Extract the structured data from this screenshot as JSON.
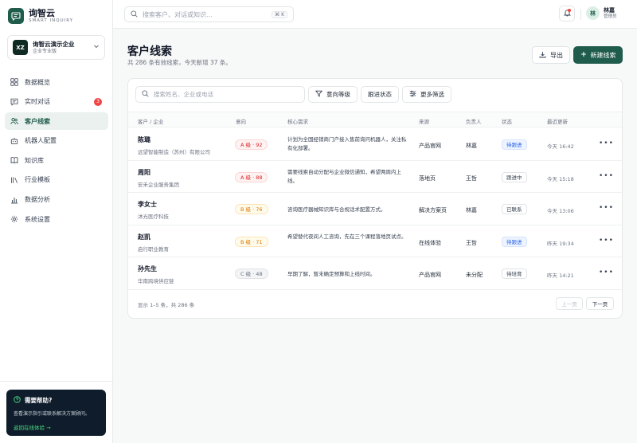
{
  "brand": {
    "name": "询智云",
    "tagline": "SMART INQUIRY"
  },
  "org": {
    "avatar": "XZ",
    "name": "询智云演示企业",
    "plan": "企业专业版"
  },
  "nav": [
    {
      "label": "数据概览",
      "icon": "grid-icon"
    },
    {
      "label": "实时对话",
      "icon": "chat-icon",
      "badge": "3"
    },
    {
      "label": "客户线索",
      "icon": "users-icon",
      "active": true
    },
    {
      "label": "机器人配置",
      "icon": "robot-icon"
    },
    {
      "label": "知识库",
      "icon": "book-icon"
    },
    {
      "label": "行业模板",
      "icon": "library-icon"
    },
    {
      "label": "数据分析",
      "icon": "bar-chart-icon"
    },
    {
      "label": "系统设置",
      "icon": "gear-icon"
    }
  ],
  "help": {
    "title": "需要帮助?",
    "desc": "查看演示指引或联系解决方案顾问。",
    "link": "返回在线体验 →"
  },
  "topbar": {
    "search_placeholder": "搜索客户、对话或知识...",
    "shortcut": "⌘ K",
    "user": {
      "avatar": "林",
      "name": "林嘉",
      "role": "管理员"
    }
  },
  "page": {
    "title": "客户线索",
    "subtitle": "共 286 条有效线索，今天新增 37 条。",
    "export_label": "导出",
    "new_label": "新建线索"
  },
  "filters": {
    "search_placeholder": "搜索姓名、企业或电话",
    "intent_label": "意向等级",
    "follow_label": "跟进状态",
    "more_label": "更多筛选"
  },
  "table": {
    "columns": [
      "客户 / 企业",
      "意向",
      "核心需求",
      "来源",
      "负责人",
      "状态",
      "最近更新"
    ],
    "rows": [
      {
        "name": "陈璐",
        "company": "远望智能制造（苏州）有限公司",
        "grade": "A 级 · 92",
        "level": "a",
        "need": "计划为全国经销商门户接入售前询问机器人，关注私有化部署。",
        "source": "产品官网",
        "owner": "林嘉",
        "status": "待跟进",
        "status_style": "blue",
        "updated": "今天 16:42"
      },
      {
        "name": "周阳",
        "company": "安禾企业服务集团",
        "grade": "A 级 · 88",
        "level": "a",
        "need": "需要线索自动分配与企业微信通知，希望两周内上线。",
        "source": "落地页",
        "owner": "王哲",
        "status": "跟进中",
        "status_style": "plain",
        "updated": "今天 15:18"
      },
      {
        "name": "李女士",
        "company": "沐光医疗科技",
        "grade": "B 级 · 76",
        "level": "b",
        "need": "咨询医疗器械知识库与合规话术配置方式。",
        "source": "解决方案页",
        "owner": "林嘉",
        "status": "已联系",
        "status_style": "plain",
        "updated": "今天 13:06"
      },
      {
        "name": "赵凯",
        "company": "启行职业教育",
        "grade": "B 级 · 71",
        "level": "b",
        "need": "希望替代夜间人工咨询，先在三个课程落地页试点。",
        "source": "在线体验",
        "owner": "王哲",
        "status": "待跟进",
        "status_style": "blue",
        "updated": "昨天 19:34"
      },
      {
        "name": "孙先生",
        "company": "华南跨境供应链",
        "grade": "C 级 · 48",
        "level": "c",
        "need": "早期了解，暂未确定预算和上线时间。",
        "source": "产品官网",
        "owner": "未分配",
        "status": "待培育",
        "status_style": "plain",
        "updated": "昨天 14:21"
      }
    ],
    "more_glyph": "•••"
  },
  "pagination": {
    "summary": "显示 1–5 条，共 286 条",
    "prev": "上一页",
    "next": "下一页"
  },
  "colors": {
    "brand": "#1f5c4b",
    "danger": "#ef4444",
    "info": "#2563eb"
  }
}
